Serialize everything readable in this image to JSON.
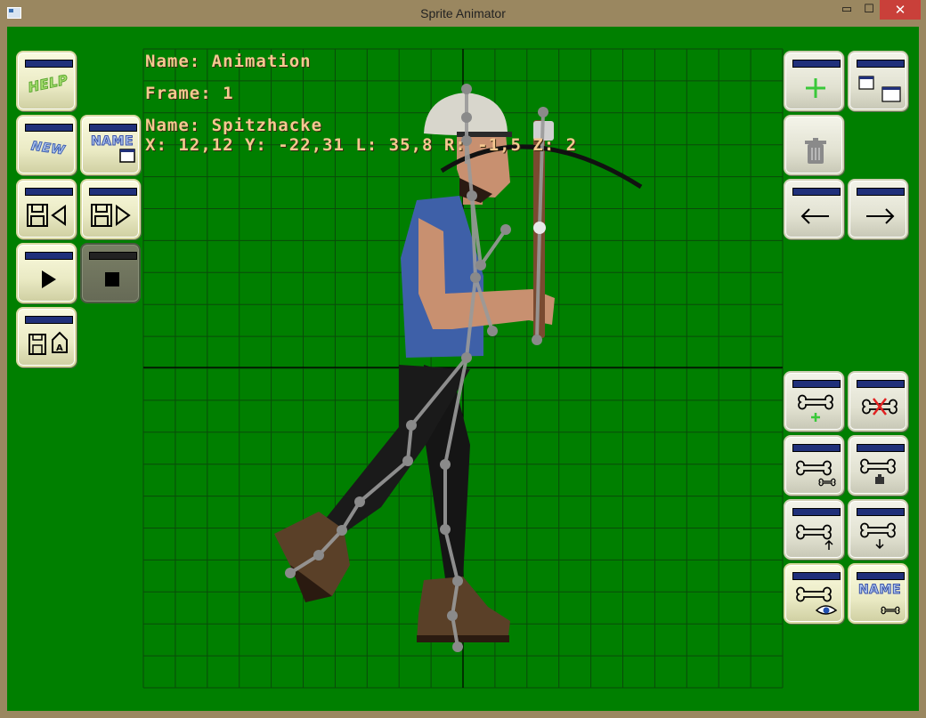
{
  "window": {
    "title": "Sprite Animator",
    "controls": {
      "minimize": "▭",
      "maximize": "☐",
      "close": "✕"
    }
  },
  "info": {
    "animation_line": "Name: Animation",
    "frame_line": "Frame: 1",
    "bone_name_line": "Name: Spitzhacke",
    "bone_coords_line": "X: 12,12 Y: -22,31 L: 35,8 R: -1,5 Z: 2"
  },
  "toolbar_left": {
    "help_label": "HELP",
    "new_label": "NEW",
    "rename_label": "NAME",
    "load_icon": "disk-load-icon",
    "save_icon": "disk-save-icon",
    "play_icon": "play-icon",
    "stop_icon": "stop-icon",
    "export_icon": "export-sprite-icon"
  },
  "toolbar_right": {
    "add_frame_icon": "plus-icon",
    "duplicate_icon": "windows-icon",
    "delete_frame_icon": "trash-icon",
    "prev_frame_icon": "arrow-left-icon",
    "next_frame_icon": "arrow-right-icon",
    "add_bone_icon": "bone-plus-icon",
    "delete_bone_icon": "bone-x-icon",
    "bone_sprite_icon": "bone-sprite-icon",
    "bone_image_icon": "bone-image-icon",
    "bone_up_icon": "bone-up-icon",
    "bone_down_icon": "bone-down-icon",
    "bone_visibility_icon": "bone-eye-icon",
    "rename_bone_label": "NAME"
  },
  "colors": {
    "background": "#007f00",
    "grid": "#0a4a0a",
    "axis": "#000000",
    "text": "#f4c890",
    "bone": "#9a9a9a",
    "close_button": "#c9403a"
  }
}
